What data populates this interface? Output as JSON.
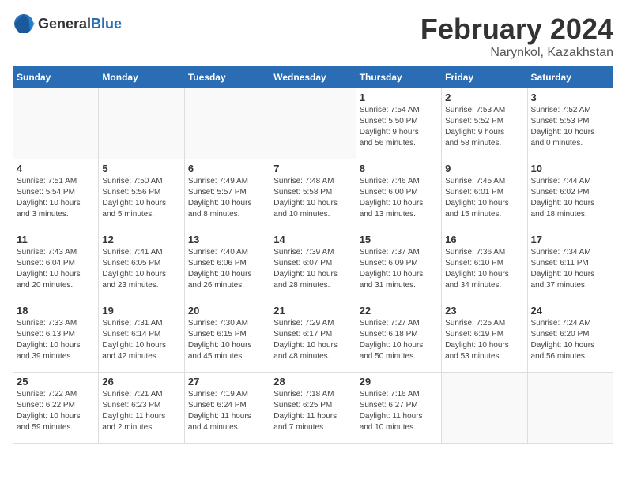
{
  "logo": {
    "general": "General",
    "blue": "Blue"
  },
  "title": "February 2024",
  "subtitle": "Narynkol, Kazakhstan",
  "days_header": [
    "Sunday",
    "Monday",
    "Tuesday",
    "Wednesday",
    "Thursday",
    "Friday",
    "Saturday"
  ],
  "weeks": [
    [
      {
        "day": "",
        "info": ""
      },
      {
        "day": "",
        "info": ""
      },
      {
        "day": "",
        "info": ""
      },
      {
        "day": "",
        "info": ""
      },
      {
        "day": "1",
        "info": "Sunrise: 7:54 AM\nSunset: 5:50 PM\nDaylight: 9 hours\nand 56 minutes."
      },
      {
        "day": "2",
        "info": "Sunrise: 7:53 AM\nSunset: 5:52 PM\nDaylight: 9 hours\nand 58 minutes."
      },
      {
        "day": "3",
        "info": "Sunrise: 7:52 AM\nSunset: 5:53 PM\nDaylight: 10 hours\nand 0 minutes."
      }
    ],
    [
      {
        "day": "4",
        "info": "Sunrise: 7:51 AM\nSunset: 5:54 PM\nDaylight: 10 hours\nand 3 minutes."
      },
      {
        "day": "5",
        "info": "Sunrise: 7:50 AM\nSunset: 5:56 PM\nDaylight: 10 hours\nand 5 minutes."
      },
      {
        "day": "6",
        "info": "Sunrise: 7:49 AM\nSunset: 5:57 PM\nDaylight: 10 hours\nand 8 minutes."
      },
      {
        "day": "7",
        "info": "Sunrise: 7:48 AM\nSunset: 5:58 PM\nDaylight: 10 hours\nand 10 minutes."
      },
      {
        "day": "8",
        "info": "Sunrise: 7:46 AM\nSunset: 6:00 PM\nDaylight: 10 hours\nand 13 minutes."
      },
      {
        "day": "9",
        "info": "Sunrise: 7:45 AM\nSunset: 6:01 PM\nDaylight: 10 hours\nand 15 minutes."
      },
      {
        "day": "10",
        "info": "Sunrise: 7:44 AM\nSunset: 6:02 PM\nDaylight: 10 hours\nand 18 minutes."
      }
    ],
    [
      {
        "day": "11",
        "info": "Sunrise: 7:43 AM\nSunset: 6:04 PM\nDaylight: 10 hours\nand 20 minutes."
      },
      {
        "day": "12",
        "info": "Sunrise: 7:41 AM\nSunset: 6:05 PM\nDaylight: 10 hours\nand 23 minutes."
      },
      {
        "day": "13",
        "info": "Sunrise: 7:40 AM\nSunset: 6:06 PM\nDaylight: 10 hours\nand 26 minutes."
      },
      {
        "day": "14",
        "info": "Sunrise: 7:39 AM\nSunset: 6:07 PM\nDaylight: 10 hours\nand 28 minutes."
      },
      {
        "day": "15",
        "info": "Sunrise: 7:37 AM\nSunset: 6:09 PM\nDaylight: 10 hours\nand 31 minutes."
      },
      {
        "day": "16",
        "info": "Sunrise: 7:36 AM\nSunset: 6:10 PM\nDaylight: 10 hours\nand 34 minutes."
      },
      {
        "day": "17",
        "info": "Sunrise: 7:34 AM\nSunset: 6:11 PM\nDaylight: 10 hours\nand 37 minutes."
      }
    ],
    [
      {
        "day": "18",
        "info": "Sunrise: 7:33 AM\nSunset: 6:13 PM\nDaylight: 10 hours\nand 39 minutes."
      },
      {
        "day": "19",
        "info": "Sunrise: 7:31 AM\nSunset: 6:14 PM\nDaylight: 10 hours\nand 42 minutes."
      },
      {
        "day": "20",
        "info": "Sunrise: 7:30 AM\nSunset: 6:15 PM\nDaylight: 10 hours\nand 45 minutes."
      },
      {
        "day": "21",
        "info": "Sunrise: 7:29 AM\nSunset: 6:17 PM\nDaylight: 10 hours\nand 48 minutes."
      },
      {
        "day": "22",
        "info": "Sunrise: 7:27 AM\nSunset: 6:18 PM\nDaylight: 10 hours\nand 50 minutes."
      },
      {
        "day": "23",
        "info": "Sunrise: 7:25 AM\nSunset: 6:19 PM\nDaylight: 10 hours\nand 53 minutes."
      },
      {
        "day": "24",
        "info": "Sunrise: 7:24 AM\nSunset: 6:20 PM\nDaylight: 10 hours\nand 56 minutes."
      }
    ],
    [
      {
        "day": "25",
        "info": "Sunrise: 7:22 AM\nSunset: 6:22 PM\nDaylight: 10 hours\nand 59 minutes."
      },
      {
        "day": "26",
        "info": "Sunrise: 7:21 AM\nSunset: 6:23 PM\nDaylight: 11 hours\nand 2 minutes."
      },
      {
        "day": "27",
        "info": "Sunrise: 7:19 AM\nSunset: 6:24 PM\nDaylight: 11 hours\nand 4 minutes."
      },
      {
        "day": "28",
        "info": "Sunrise: 7:18 AM\nSunset: 6:25 PM\nDaylight: 11 hours\nand 7 minutes."
      },
      {
        "day": "29",
        "info": "Sunrise: 7:16 AM\nSunset: 6:27 PM\nDaylight: 11 hours\nand 10 minutes."
      },
      {
        "day": "",
        "info": ""
      },
      {
        "day": "",
        "info": ""
      }
    ]
  ]
}
